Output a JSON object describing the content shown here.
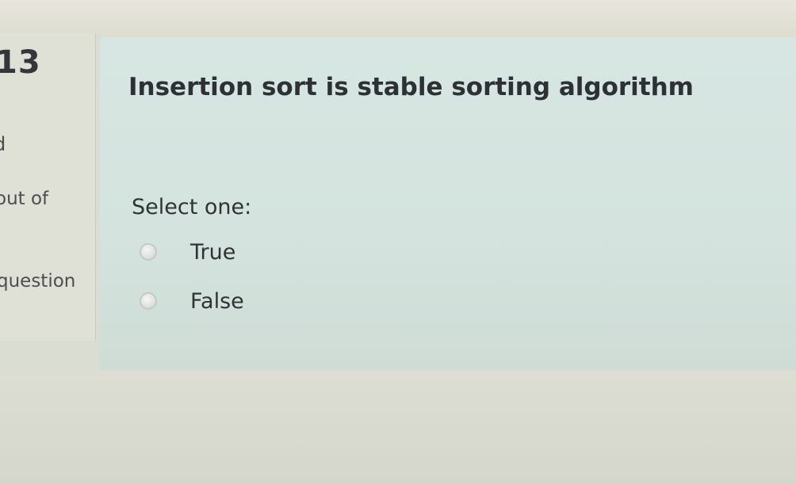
{
  "info": {
    "number": "13",
    "frag_d": "d",
    "frag_outof": "out of",
    "frag_question": "question"
  },
  "question": {
    "text": "Insertion sort is stable sorting algorithm",
    "prompt": "Select one:",
    "options": [
      {
        "label": "True",
        "selected": false
      },
      {
        "label": "False",
        "selected": false
      }
    ]
  }
}
